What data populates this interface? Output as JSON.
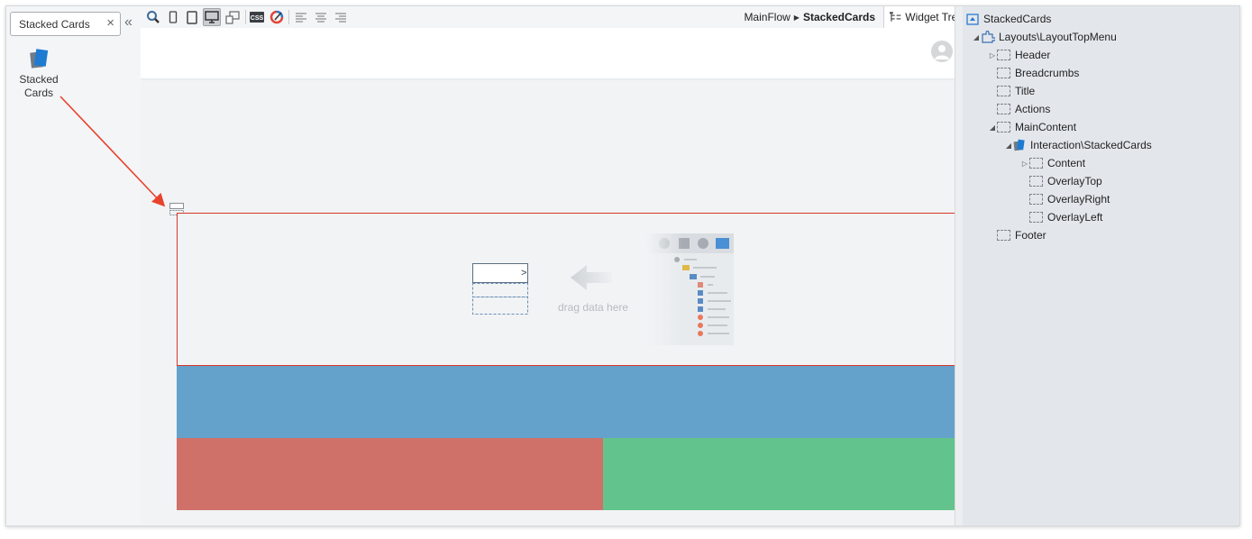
{
  "left_panel": {
    "search_value": "Stacked Cards",
    "close_glyph": "×",
    "collapse_glyph": "«",
    "widget": {
      "label": "Stacked\nCards",
      "icon": "stacked-cards-icon"
    }
  },
  "toolbar": {
    "breadcrumb_flow": "MainFlow",
    "breadcrumb_screen": "StackedCards",
    "tab_widget_tree": "Widget Tree",
    "buttons": [
      "zoom-icon",
      "phone-icon",
      "tablet-icon",
      "desktop-icon",
      "multi-device-icon",
      "css-icon",
      "theme-icon",
      "align-left-icon",
      "align-center-icon",
      "align-right-icon"
    ]
  },
  "canvas": {
    "drag_hint": "drag data here",
    "card_colors": {
      "blue": "#65a2cb",
      "red": "#cf7069",
      "green": "#63c38c",
      "selection": "#d9362a"
    }
  },
  "widget_tree": {
    "items": [
      {
        "label": "StackedCards",
        "icon": "screen-icon",
        "toggle": ""
      },
      {
        "label": "Layouts\\LayoutTopMenu",
        "icon": "puzzle-icon",
        "toggle": "expanded"
      },
      {
        "label": "Header",
        "icon": "placeholder-icon",
        "toggle": "collapsed"
      },
      {
        "label": "Breadcrumbs",
        "icon": "placeholder-icon",
        "toggle": ""
      },
      {
        "label": "Title",
        "icon": "placeholder-icon",
        "toggle": ""
      },
      {
        "label": "Actions",
        "icon": "placeholder-icon",
        "toggle": ""
      },
      {
        "label": "MainContent",
        "icon": "placeholder-icon",
        "toggle": "expanded"
      },
      {
        "label": "Interaction\\StackedCards",
        "icon": "stacked-cards-icon",
        "toggle": "expanded"
      },
      {
        "label": "Content",
        "icon": "placeholder-icon",
        "toggle": "collapsed"
      },
      {
        "label": "OverlayTop",
        "icon": "placeholder-icon",
        "toggle": ""
      },
      {
        "label": "OverlayRight",
        "icon": "placeholder-icon",
        "toggle": ""
      },
      {
        "label": "OverlayLeft",
        "icon": "placeholder-icon",
        "toggle": ""
      },
      {
        "label": "Footer",
        "icon": "placeholder-icon",
        "toggle": ""
      }
    ]
  }
}
